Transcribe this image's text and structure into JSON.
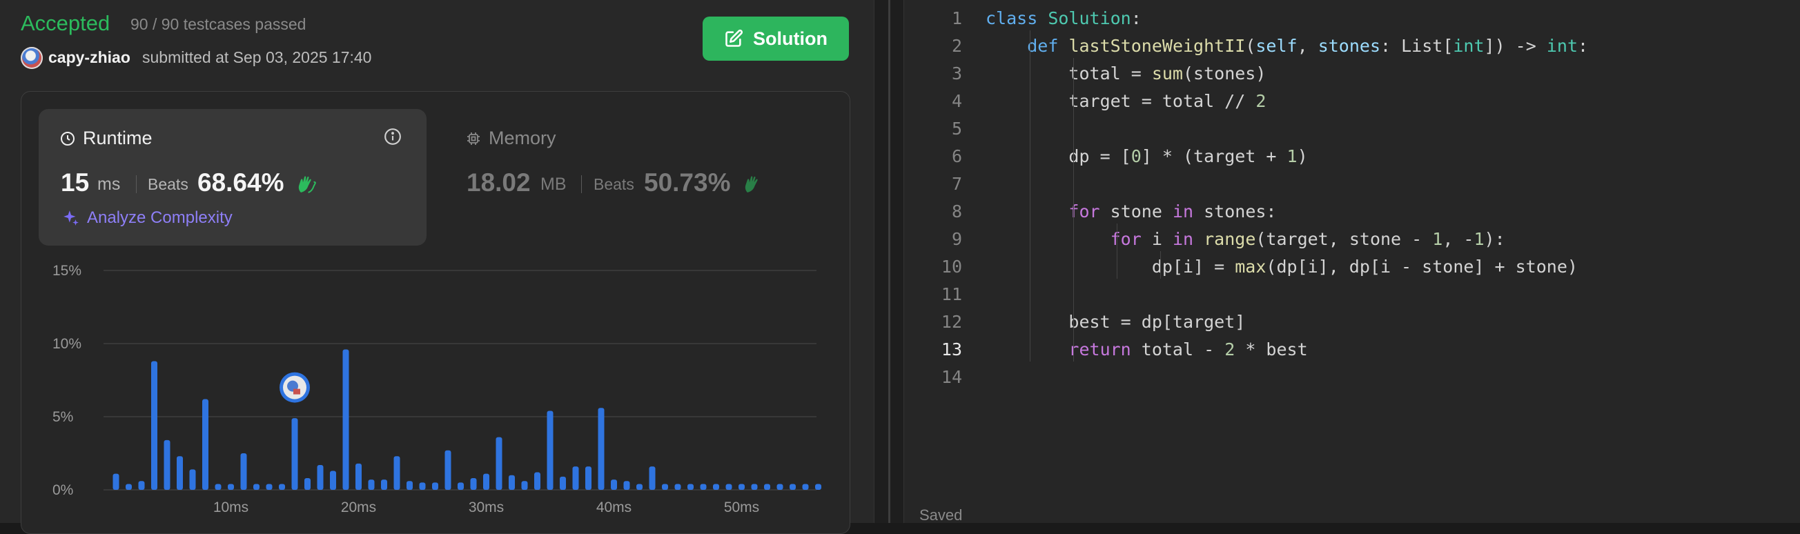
{
  "status": {
    "accepted": "Accepted",
    "testcases": "90 / 90 testcases passed",
    "user": "capy-zhiao",
    "submitted": "submitted at Sep 03, 2025 17:40",
    "solution_button": "Solution"
  },
  "runtime": {
    "title": "Runtime",
    "value": "15",
    "unit": "ms",
    "beats_label": "Beats",
    "beats_value": "68.64%",
    "analyze": "Analyze Complexity"
  },
  "memory": {
    "title": "Memory",
    "value": "18.02",
    "unit": "MB",
    "beats_label": "Beats",
    "beats_value": "50.73%"
  },
  "colors": {
    "accent_green": "#2cbb5d",
    "bar_blue": "#2f74e0",
    "analyze_purple": "#8e7ff7"
  },
  "chart_data": {
    "type": "bar",
    "y_ticks": [
      "15%",
      "10%",
      "5%",
      "0%"
    ],
    "ylim": [
      0,
      15
    ],
    "x_ticks": [
      {
        "ms": 10,
        "label": "10ms"
      },
      {
        "ms": 20,
        "label": "20ms"
      },
      {
        "ms": 30,
        "label": "30ms"
      },
      {
        "ms": 40,
        "label": "40ms"
      },
      {
        "ms": 50,
        "label": "50ms"
      }
    ],
    "x": [
      1,
      2,
      3,
      4,
      5,
      6,
      7,
      8,
      9,
      10,
      11,
      12,
      13,
      14,
      15,
      16,
      17,
      18,
      19,
      20,
      21,
      22,
      23,
      24,
      25,
      26,
      27,
      28,
      29,
      30,
      31,
      32,
      33,
      34,
      35,
      36,
      37,
      38,
      39,
      40,
      41,
      42,
      43,
      44,
      45,
      46,
      47,
      48,
      49,
      50,
      51,
      52,
      53,
      54,
      55,
      56
    ],
    "values": [
      1.1,
      0.4,
      0.6,
      8.8,
      3.4,
      2.3,
      1.4,
      6.2,
      0.4,
      0.4,
      2.5,
      0.4,
      0.4,
      0.4,
      4.9,
      0.8,
      1.7,
      1.3,
      9.6,
      1.8,
      0.7,
      0.7,
      2.3,
      0.6,
      0.5,
      0.5,
      2.7,
      0.5,
      0.8,
      1.1,
      3.6,
      1.0,
      0.6,
      1.2,
      5.4,
      0.9,
      1.6,
      1.6,
      5.6,
      0.7,
      0.6,
      0.4,
      1.6,
      0.4,
      0.4,
      0.4,
      0.4,
      0.4,
      0.4,
      0.4,
      0.4,
      0.4,
      0.4,
      0.4,
      0.4,
      0.4
    ],
    "user_marker_ms": 15,
    "user_marker_value": 7.0
  },
  "editor": {
    "lines": [
      [
        [
          "kw2",
          "class "
        ],
        [
          "ty",
          "Solution"
        ],
        [
          "op",
          ":"
        ]
      ],
      [
        [
          "op",
          "    "
        ],
        [
          "kw2",
          "def "
        ],
        [
          "fn",
          "lastStoneWeightII"
        ],
        [
          "op",
          "("
        ],
        [
          "param",
          "self"
        ],
        [
          "op",
          ", "
        ],
        [
          "param",
          "stones"
        ],
        [
          "op",
          ": List["
        ],
        [
          "ty",
          "int"
        ],
        [
          "op",
          "]) -> "
        ],
        [
          "ty",
          "int"
        ],
        [
          "op",
          ":"
        ]
      ],
      [
        [
          "op",
          "        total = "
        ],
        [
          "fn",
          "sum"
        ],
        [
          "op",
          "(stones)"
        ]
      ],
      [
        [
          "op",
          "        target = total // "
        ],
        [
          "num",
          "2"
        ]
      ],
      [
        [
          "op",
          ""
        ]
      ],
      [
        [
          "op",
          "        dp = ["
        ],
        [
          "num",
          "0"
        ],
        [
          "op",
          "] * (target + "
        ],
        [
          "num",
          "1"
        ],
        [
          "op",
          ")"
        ]
      ],
      [
        [
          "op",
          ""
        ]
      ],
      [
        [
          "op",
          "        "
        ],
        [
          "kw",
          "for "
        ],
        [
          "op",
          "stone "
        ],
        [
          "kw",
          "in "
        ],
        [
          "op",
          "stones:"
        ]
      ],
      [
        [
          "op",
          "            "
        ],
        [
          "kw",
          "for "
        ],
        [
          "op",
          "i "
        ],
        [
          "kw",
          "in "
        ],
        [
          "fn",
          "range"
        ],
        [
          "op",
          "(target, stone - "
        ],
        [
          "num",
          "1"
        ],
        [
          "op",
          ", -"
        ],
        [
          "num",
          "1"
        ],
        [
          "op",
          "):"
        ]
      ],
      [
        [
          "op",
          "                dp[i] = "
        ],
        [
          "fn",
          "max"
        ],
        [
          "op",
          "(dp[i], dp[i - stone] + stone)"
        ]
      ],
      [
        [
          "op",
          ""
        ]
      ],
      [
        [
          "op",
          "        best = dp[target]"
        ]
      ],
      [
        [
          "op",
          "        "
        ],
        [
          "kw",
          "return "
        ],
        [
          "op",
          "total - "
        ],
        [
          "num",
          "2"
        ],
        [
          "op",
          " * best"
        ]
      ],
      [
        [
          "op",
          ""
        ]
      ]
    ],
    "active_line": 13,
    "saved": "Saved"
  }
}
